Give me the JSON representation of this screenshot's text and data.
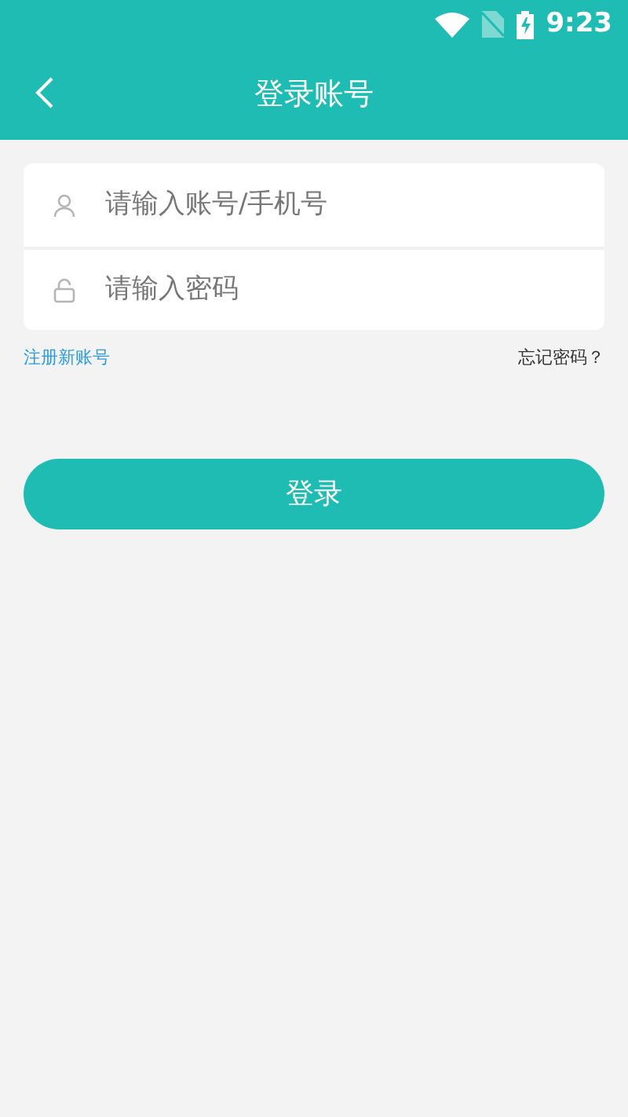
{
  "status_bar": {
    "time": "9:23"
  },
  "header": {
    "title": "登录账号"
  },
  "fields": [
    {
      "kind": "user",
      "placeholder": "请输入账号/手机号"
    },
    {
      "kind": "lock",
      "placeholder": "请输入密码"
    }
  ],
  "links": {
    "register": "注册新账号",
    "forgot": "忘记密码？"
  },
  "login_button": "登录"
}
